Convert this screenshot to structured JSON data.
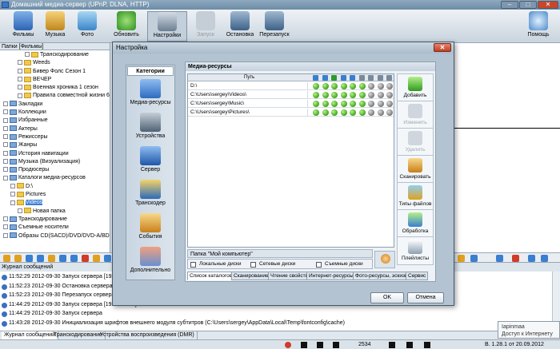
{
  "window": {
    "title": "Домашний медиа-сервер (UPnP, DLNA, HTTP)",
    "min": "–",
    "max": "□",
    "close": "✕"
  },
  "toolbar": {
    "films": "Фильмы",
    "music": "Музыка",
    "photo": "Фото",
    "refresh": "Обновить",
    "settings": "Настройки",
    "start": "Запуск",
    "stop": "Остановка",
    "restart": "Перезапуск",
    "help": "Помощь"
  },
  "leftpane": {
    "header": "Папки [Фильмы]"
  },
  "tree": [
    {
      "label": "Транскодирование",
      "indent": 3,
      "folder": true
    },
    {
      "label": "Weeds",
      "indent": 2,
      "folder": true
    },
    {
      "label": "Бивер Фолс Сезон 1",
      "indent": 2,
      "folder": true
    },
    {
      "label": "ВЕЧЕР",
      "indent": 2,
      "folder": true
    },
    {
      "label": "Военная хроника 1 сезон",
      "indent": 2,
      "folder": true
    },
    {
      "label": "Правила совместной жизни 6 сезон",
      "indent": 2,
      "folder": true
    },
    {
      "label": "Закладки",
      "indent": 0,
      "folder": false
    },
    {
      "label": "Коллекции",
      "indent": 0,
      "folder": false
    },
    {
      "label": "Избранные",
      "indent": 0,
      "folder": false
    },
    {
      "label": "Актеры",
      "indent": 0,
      "folder": false
    },
    {
      "label": "Режиссеры",
      "indent": 0,
      "folder": false
    },
    {
      "label": "Жанры",
      "indent": 0,
      "folder": false
    },
    {
      "label": "История навигации",
      "indent": 0,
      "folder": false
    },
    {
      "label": "Музыка (Визуализация)",
      "indent": 0,
      "folder": false
    },
    {
      "label": "Продюсеры",
      "indent": 0,
      "folder": false
    },
    {
      "label": "Каталоги медиа-ресурсов",
      "indent": 0,
      "folder": false
    },
    {
      "label": "D:\\",
      "indent": 1,
      "folder": true
    },
    {
      "label": "Pictures",
      "indent": 1,
      "folder": true
    },
    {
      "label": "Videos",
      "indent": 1,
      "folder": true,
      "selected": true
    },
    {
      "label": "Новая папка",
      "indent": 2,
      "folder": true
    },
    {
      "label": "Транскодирование",
      "indent": 0,
      "folder": false
    },
    {
      "label": "Съемные носители",
      "indent": 0,
      "folder": false
    },
    {
      "label": "Образы CD(SACD)/DVD/DVD-A/BD (ISO)",
      "indent": 0,
      "folder": false
    }
  ],
  "log": {
    "header": "Журнал сообщений",
    "rows": [
      "11:52:29 2012-09-30 Запуск сервера [192.168.",
      "11:52:23 2012-09-30 Остановка сервера [192.",
      "11:52:23 2012-09-30 Перезапуск сервера",
      "11:44:29 2012-09-30 Запуск сервера [192.168.1.4]",
      "11:44:29 2012-09-30 Запуск сервера",
      "11:43:28 2012-09-30 Инициализация шрифтов внешнего модуля субтитров (C:\\Users\\sergey\\AppData\\Local\\Temp\\fontconfig\\cache)"
    ]
  },
  "bottomtabs": [
    "Журнал сообщений",
    "Транскодирование",
    "Устройства воспроизведения (DMR)"
  ],
  "status": {
    "count": "2534",
    "version": "В. 1.28.1 от 20.09.2012"
  },
  "tooltip": {
    "title": "Iapinmaa",
    "text": "Доступ к Интернету"
  },
  "dialog": {
    "title": "Настройка",
    "close": "✕",
    "categories_header": "Категории",
    "categories": [
      "Медиа-ресурсы",
      "Устройства",
      "Сервер",
      "Транскодер",
      "События",
      "Дополнительно"
    ],
    "section_title": "Медиа-ресурсы",
    "grid_header": "Путь",
    "paths": [
      "D:\\",
      "C:\\Users\\sergey\\Videos\\",
      "C:\\Users\\sergey\\Music\\",
      "C:\\Users\\sergey\\Pictures\\"
    ],
    "buttons": [
      "Добавить",
      "Изменить",
      "Удалить",
      "Сканировать",
      "Типы файлов",
      "Обработка",
      "Плейлисты"
    ],
    "mycomp_label": "Папка \"Мой компьютер\"",
    "checkboxes": [
      "Локальные диски",
      "Сетевые диски",
      "Съемные диски"
    ],
    "tabs": [
      "Список каталогов",
      "Сканирование",
      "Чтение свойств",
      "Интернет-ресурсы",
      "Фото-ресурсы, эскизы",
      "Сервис"
    ],
    "ok": "OK",
    "cancel": "Отмена"
  }
}
